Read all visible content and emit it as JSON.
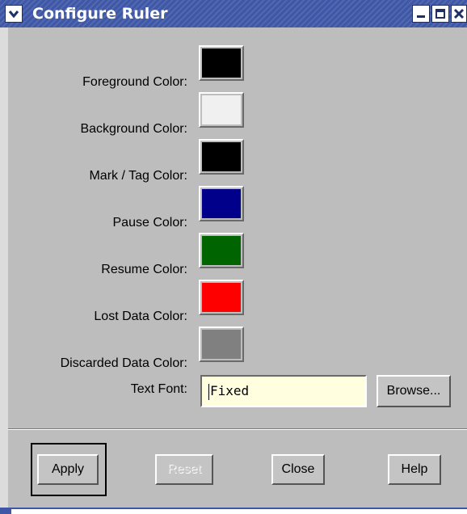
{
  "window": {
    "title": "Configure Ruler",
    "titlebar_color": "#3e57a6",
    "icons": {
      "menu": "chevron-down-icon",
      "minimize": "minimize-icon",
      "maximize": "maximize-icon",
      "close": "close-icon"
    }
  },
  "colors": [
    {
      "label": "Foreground Color:",
      "color": "#000000"
    },
    {
      "label": "Background Color:",
      "color": "#f0f0f0"
    },
    {
      "label": "Mark / Tag Color:",
      "color": "#000000"
    },
    {
      "label": "Pause Color:",
      "color": "#00008b"
    },
    {
      "label": "Resume Color:",
      "color": "#006400"
    },
    {
      "label": "Lost Data Color:",
      "color": "#ff0000"
    },
    {
      "label": "Discarded Data Color:",
      "color": "#808080"
    }
  ],
  "font": {
    "label": "Text Font:",
    "value": "Fixed",
    "browse_label": "Browse..."
  },
  "buttons": {
    "apply": "Apply",
    "reset": "Reset",
    "close": "Close",
    "help": "Help"
  }
}
